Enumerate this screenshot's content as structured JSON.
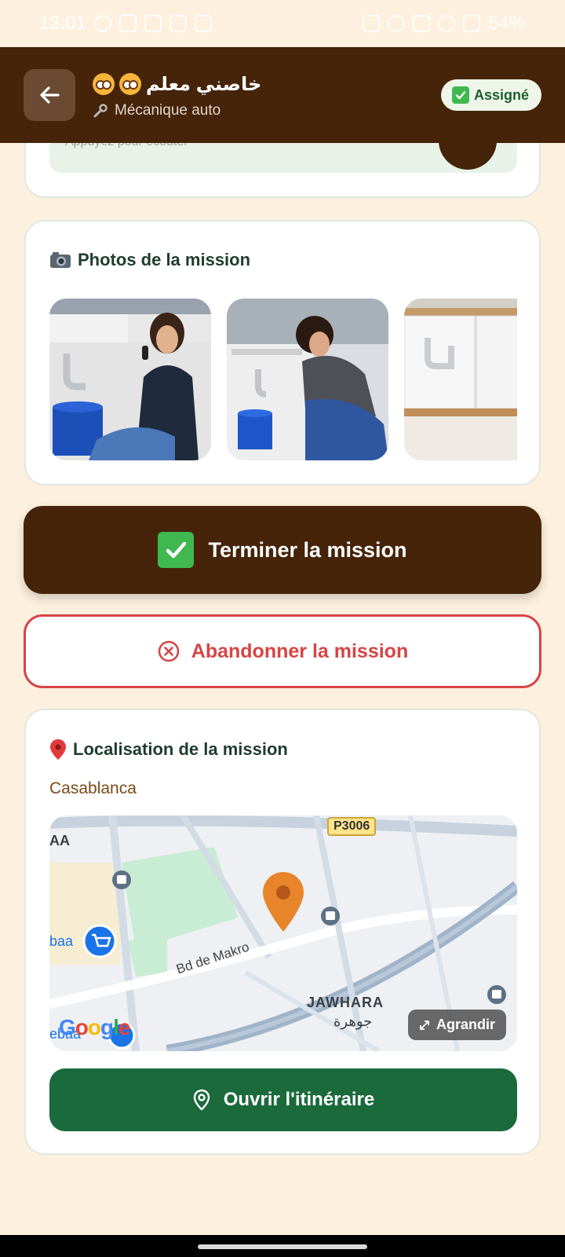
{
  "status_bar": {
    "time": "13:01",
    "battery": "54%"
  },
  "header": {
    "title": "خاصني معلم",
    "subtitle": "Mécanique auto",
    "status_badge": "Assigné",
    "colors": {
      "background": "#45240a",
      "badge_text": "#1d5e2f"
    }
  },
  "audio": {
    "hint": "Appuyez pour écouter"
  },
  "photos": {
    "title": "Photos de la mission",
    "items": [
      {
        "icon": "photo-woman-phone-leak"
      },
      {
        "icon": "photo-woman-bucket-leak"
      },
      {
        "icon": "photo-sink-pipes-plumber"
      }
    ]
  },
  "actions": {
    "complete_label": "Terminer la mission",
    "abandon_label": "Abandonner la mission",
    "colors": {
      "complete_bg": "#45240a",
      "abandon": "#d64545"
    }
  },
  "location": {
    "title": "Localisation de la mission",
    "city": "Casablanca",
    "map": {
      "road_shield": "P3006",
      "street": "Bd de Makro",
      "district_latin": "JAWHARA",
      "district_arabic": "جوهرة",
      "left_edge_top": "AA",
      "left_edge_mid": "baa",
      "left_edge_bottom": "ebaa",
      "expand_label": "Agrandir",
      "attribution": "Google"
    },
    "route_label": "Ouvrir l'itinéraire",
    "colors": {
      "route_bg": "#1b6a3c"
    }
  }
}
